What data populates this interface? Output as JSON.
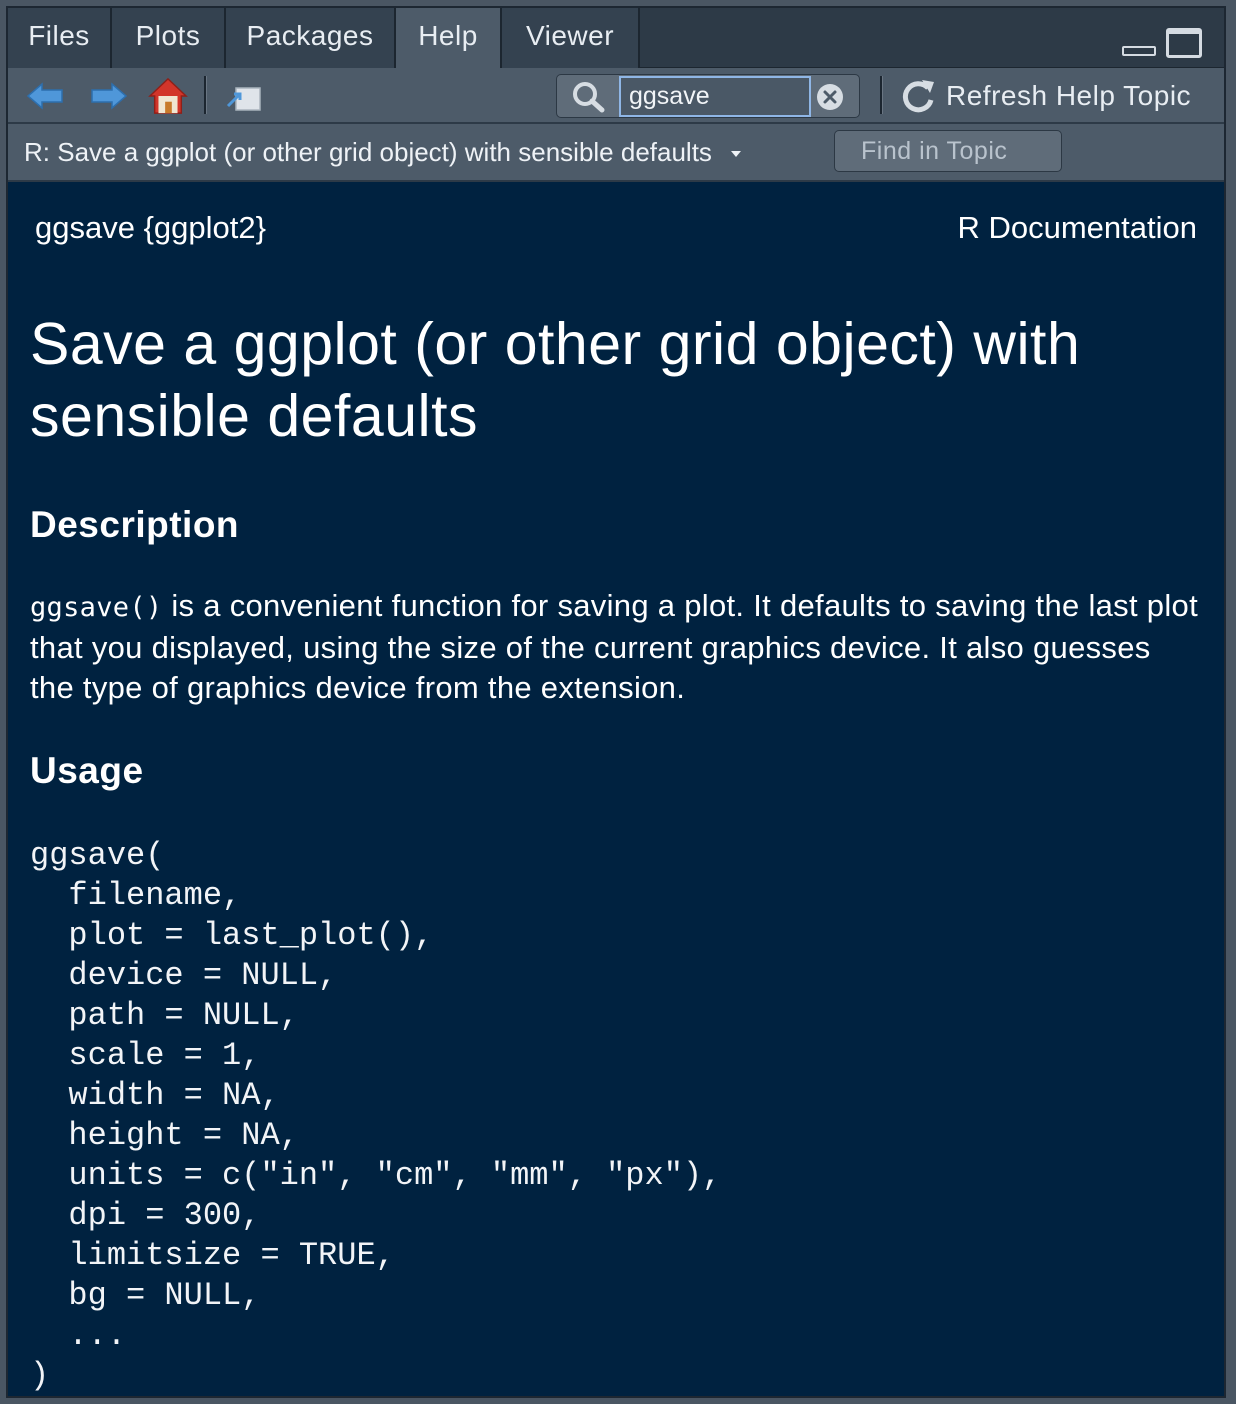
{
  "tabs": [
    {
      "label": "Files"
    },
    {
      "label": "Plots"
    },
    {
      "label": "Packages"
    },
    {
      "label": "Help",
      "active": true
    },
    {
      "label": "Viewer"
    }
  ],
  "toolbar": {
    "search_value": "ggsave",
    "refresh_label": "Refresh Help Topic",
    "icons": [
      "back-arrow-icon",
      "forward-arrow-icon",
      "home-icon",
      "popout-icon",
      "search-icon",
      "clear-icon",
      "refresh-icon"
    ]
  },
  "topicbar": {
    "selected_topic": "R: Save a ggplot (or other grid object) with sensible defaults",
    "find_placeholder": "Find in Topic"
  },
  "doc": {
    "header_left": "ggsave {ggplot2}",
    "header_right": "R Documentation",
    "title": "Save a ggplot (or other grid object) with sensible defaults",
    "description_heading": "Description",
    "description_code": "ggsave()",
    "description_text": " is a convenient function for saving a plot. It defaults to saving the last plot that you displayed, using the size of the current graphics device. It also guesses the type of graphics device from the extension.",
    "usage_heading": "Usage",
    "usage_lines": [
      "ggsave(",
      "  filename,",
      "  plot = last_plot(),",
      "  device = NULL,",
      "  path = NULL,",
      "  scale = 1,",
      "  width = NA,",
      "  height = NA,",
      "  units = c(\"in\", \"cm\", \"mm\", \"px\"),",
      "  dpi = 300,",
      "  limitsize = TRUE,",
      "  bg = NULL,",
      "  ...",
      ")"
    ]
  },
  "colors": {
    "content_bg": "#002240",
    "toolbar_bg": "#4d5b69",
    "tabbar_bg": "#2d3a47",
    "focus_border": "#8fb6e6"
  }
}
